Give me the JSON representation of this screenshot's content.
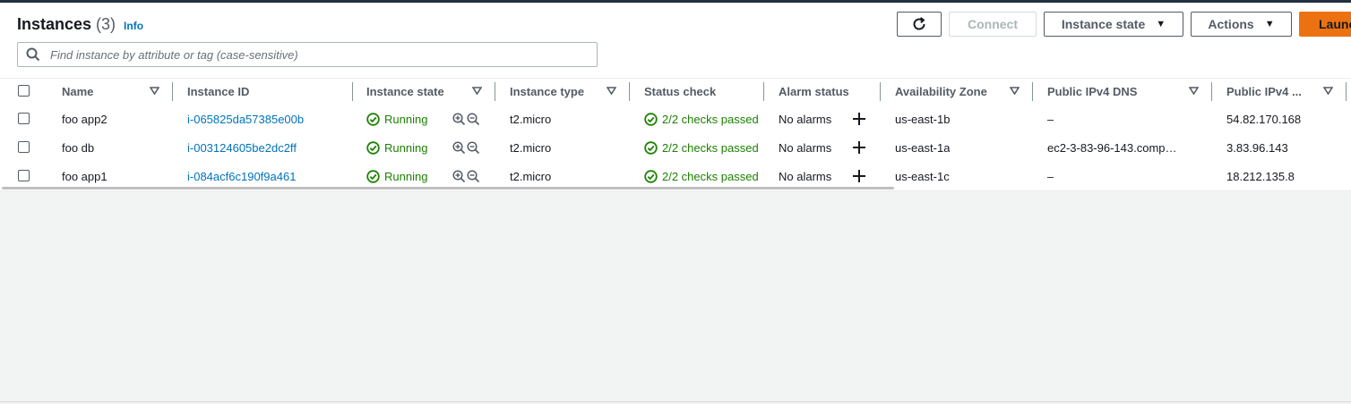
{
  "header": {
    "title": "Instances",
    "count": "(3)",
    "info": "Info"
  },
  "toolbar": {
    "refresh_icon": "refresh-icon",
    "connect_label": "Connect",
    "instance_state_label": "Instance state",
    "actions_label": "Actions",
    "launch_label": "Launc"
  },
  "search": {
    "placeholder": "Find instance by attribute or tag (case-sensitive)",
    "value": ""
  },
  "columns": {
    "name": "Name",
    "instance_id": "Instance ID",
    "instance_state": "Instance state",
    "instance_type": "Instance type",
    "status_check": "Status check",
    "alarm_status": "Alarm status",
    "availability_zone": "Availability Zone",
    "public_dns": "Public IPv4 DNS",
    "public_ip": "Public IPv4 ..."
  },
  "rows": [
    {
      "name": "foo app2",
      "instance_id": "i-065825da57385e00b",
      "state": "Running",
      "type": "t2.micro",
      "status_check": "2/2 checks passed",
      "alarm": "No alarms",
      "zone": "us-east-1b",
      "dns": "–",
      "ip": "54.82.170.168"
    },
    {
      "name": "foo db",
      "instance_id": "i-003124605be2dc2ff",
      "state": "Running",
      "type": "t2.micro",
      "status_check": "2/2 checks passed",
      "alarm": "No alarms",
      "zone": "us-east-1a",
      "dns": "ec2-3-83-96-143.comp…",
      "ip": "3.83.96.143"
    },
    {
      "name": "foo app1",
      "instance_id": "i-084acf6c190f9a461",
      "state": "Running",
      "type": "t2.micro",
      "status_check": "2/2 checks passed",
      "alarm": "No alarms",
      "zone": "us-east-1c",
      "dns": "–",
      "ip": "18.212.135.8"
    }
  ],
  "colors": {
    "link": "#0073bb",
    "success": "#1d8102",
    "primary_button": "#ec7211",
    "header_bar": "#232f3e"
  }
}
